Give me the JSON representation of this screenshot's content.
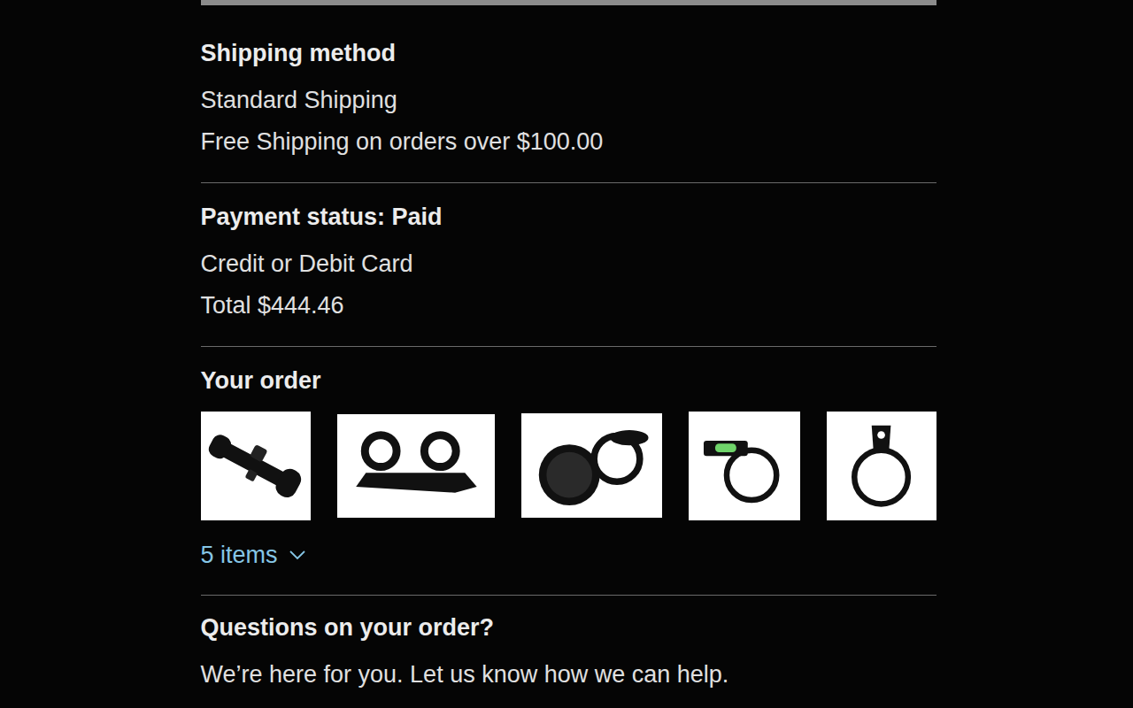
{
  "shipping": {
    "heading": "Shipping method",
    "method": "Standard Shipping",
    "note": "Free Shipping on orders over $100.00"
  },
  "payment": {
    "heading": "Payment status: Paid",
    "method": "Credit or Debit Card",
    "total": "Total $444.46"
  },
  "order": {
    "heading": "Your order",
    "products": [
      {
        "kind": "scope"
      },
      {
        "kind": "mount"
      },
      {
        "kind": "caps"
      },
      {
        "kind": "level"
      },
      {
        "kind": "lever"
      }
    ],
    "toggle": {
      "label": "5 items",
      "expanded": false
    }
  },
  "help": {
    "heading": "Questions on your order?",
    "text": "We’re here for you. Let us know how we can help."
  }
}
